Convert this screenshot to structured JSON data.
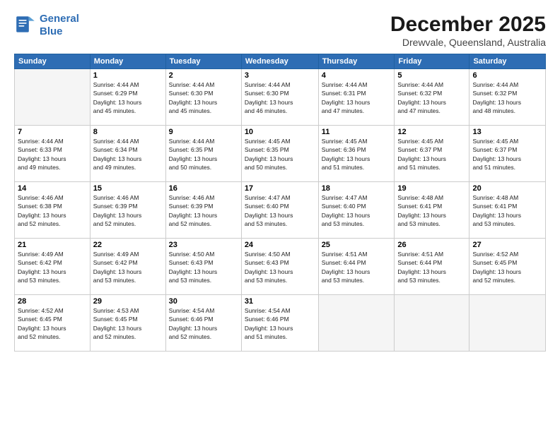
{
  "header": {
    "logo_line1": "General",
    "logo_line2": "Blue",
    "month": "December 2025",
    "location": "Drewvale, Queensland, Australia"
  },
  "weekdays": [
    "Sunday",
    "Monday",
    "Tuesday",
    "Wednesday",
    "Thursday",
    "Friday",
    "Saturday"
  ],
  "weeks": [
    [
      {
        "day": "",
        "info": ""
      },
      {
        "day": "1",
        "info": "Sunrise: 4:44 AM\nSunset: 6:29 PM\nDaylight: 13 hours\nand 45 minutes."
      },
      {
        "day": "2",
        "info": "Sunrise: 4:44 AM\nSunset: 6:30 PM\nDaylight: 13 hours\nand 45 minutes."
      },
      {
        "day": "3",
        "info": "Sunrise: 4:44 AM\nSunset: 6:30 PM\nDaylight: 13 hours\nand 46 minutes."
      },
      {
        "day": "4",
        "info": "Sunrise: 4:44 AM\nSunset: 6:31 PM\nDaylight: 13 hours\nand 47 minutes."
      },
      {
        "day": "5",
        "info": "Sunrise: 4:44 AM\nSunset: 6:32 PM\nDaylight: 13 hours\nand 47 minutes."
      },
      {
        "day": "6",
        "info": "Sunrise: 4:44 AM\nSunset: 6:32 PM\nDaylight: 13 hours\nand 48 minutes."
      }
    ],
    [
      {
        "day": "7",
        "info": "Sunrise: 4:44 AM\nSunset: 6:33 PM\nDaylight: 13 hours\nand 49 minutes."
      },
      {
        "day": "8",
        "info": "Sunrise: 4:44 AM\nSunset: 6:34 PM\nDaylight: 13 hours\nand 49 minutes."
      },
      {
        "day": "9",
        "info": "Sunrise: 4:44 AM\nSunset: 6:35 PM\nDaylight: 13 hours\nand 50 minutes."
      },
      {
        "day": "10",
        "info": "Sunrise: 4:45 AM\nSunset: 6:35 PM\nDaylight: 13 hours\nand 50 minutes."
      },
      {
        "day": "11",
        "info": "Sunrise: 4:45 AM\nSunset: 6:36 PM\nDaylight: 13 hours\nand 51 minutes."
      },
      {
        "day": "12",
        "info": "Sunrise: 4:45 AM\nSunset: 6:37 PM\nDaylight: 13 hours\nand 51 minutes."
      },
      {
        "day": "13",
        "info": "Sunrise: 4:45 AM\nSunset: 6:37 PM\nDaylight: 13 hours\nand 51 minutes."
      }
    ],
    [
      {
        "day": "14",
        "info": "Sunrise: 4:46 AM\nSunset: 6:38 PM\nDaylight: 13 hours\nand 52 minutes."
      },
      {
        "day": "15",
        "info": "Sunrise: 4:46 AM\nSunset: 6:39 PM\nDaylight: 13 hours\nand 52 minutes."
      },
      {
        "day": "16",
        "info": "Sunrise: 4:46 AM\nSunset: 6:39 PM\nDaylight: 13 hours\nand 52 minutes."
      },
      {
        "day": "17",
        "info": "Sunrise: 4:47 AM\nSunset: 6:40 PM\nDaylight: 13 hours\nand 53 minutes."
      },
      {
        "day": "18",
        "info": "Sunrise: 4:47 AM\nSunset: 6:40 PM\nDaylight: 13 hours\nand 53 minutes."
      },
      {
        "day": "19",
        "info": "Sunrise: 4:48 AM\nSunset: 6:41 PM\nDaylight: 13 hours\nand 53 minutes."
      },
      {
        "day": "20",
        "info": "Sunrise: 4:48 AM\nSunset: 6:41 PM\nDaylight: 13 hours\nand 53 minutes."
      }
    ],
    [
      {
        "day": "21",
        "info": "Sunrise: 4:49 AM\nSunset: 6:42 PM\nDaylight: 13 hours\nand 53 minutes."
      },
      {
        "day": "22",
        "info": "Sunrise: 4:49 AM\nSunset: 6:42 PM\nDaylight: 13 hours\nand 53 minutes."
      },
      {
        "day": "23",
        "info": "Sunrise: 4:50 AM\nSunset: 6:43 PM\nDaylight: 13 hours\nand 53 minutes."
      },
      {
        "day": "24",
        "info": "Sunrise: 4:50 AM\nSunset: 6:43 PM\nDaylight: 13 hours\nand 53 minutes."
      },
      {
        "day": "25",
        "info": "Sunrise: 4:51 AM\nSunset: 6:44 PM\nDaylight: 13 hours\nand 53 minutes."
      },
      {
        "day": "26",
        "info": "Sunrise: 4:51 AM\nSunset: 6:44 PM\nDaylight: 13 hours\nand 53 minutes."
      },
      {
        "day": "27",
        "info": "Sunrise: 4:52 AM\nSunset: 6:45 PM\nDaylight: 13 hours\nand 52 minutes."
      }
    ],
    [
      {
        "day": "28",
        "info": "Sunrise: 4:52 AM\nSunset: 6:45 PM\nDaylight: 13 hours\nand 52 minutes."
      },
      {
        "day": "29",
        "info": "Sunrise: 4:53 AM\nSunset: 6:45 PM\nDaylight: 13 hours\nand 52 minutes."
      },
      {
        "day": "30",
        "info": "Sunrise: 4:54 AM\nSunset: 6:46 PM\nDaylight: 13 hours\nand 52 minutes."
      },
      {
        "day": "31",
        "info": "Sunrise: 4:54 AM\nSunset: 6:46 PM\nDaylight: 13 hours\nand 51 minutes."
      },
      {
        "day": "",
        "info": ""
      },
      {
        "day": "",
        "info": ""
      },
      {
        "day": "",
        "info": ""
      }
    ]
  ]
}
